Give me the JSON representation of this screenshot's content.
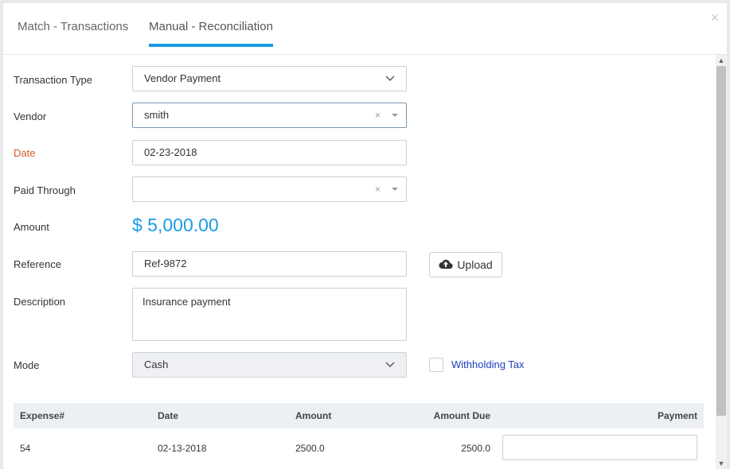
{
  "tabs": [
    {
      "label": "Match - Transactions"
    },
    {
      "label": "Manual - Reconciliation"
    }
  ],
  "close_glyph": "×",
  "form": {
    "transaction_type": {
      "label": "Transaction Type",
      "value": "Vendor Payment"
    },
    "vendor": {
      "label": "Vendor",
      "value": "smith"
    },
    "date": {
      "label": "Date",
      "value": "02-23-2018"
    },
    "paid_through": {
      "label": "Paid Through",
      "value": ""
    },
    "amount": {
      "label": "Amount",
      "value": "$ 5,000.00"
    },
    "reference": {
      "label": "Reference",
      "value": "Ref-9872"
    },
    "upload": {
      "label": "Upload",
      "icon": "cloud-upload-icon"
    },
    "description": {
      "label": "Description",
      "value": "Insurance payment"
    },
    "mode": {
      "label": "Mode",
      "value": "Cash"
    },
    "withholding_tax": {
      "label": "Withholding Tax",
      "checked": false
    }
  },
  "table": {
    "headers": [
      "Expense#",
      "Date",
      "Amount",
      "Amount Due",
      "Payment"
    ],
    "rows": [
      {
        "expense": "54",
        "date": "02-13-2018",
        "amount": "2500.0",
        "amount_due": "2500.0",
        "payment": ""
      }
    ]
  },
  "colors": {
    "accent": "#1a9be3",
    "required_label": "#d4582a",
    "link": "#1d3fbd"
  }
}
